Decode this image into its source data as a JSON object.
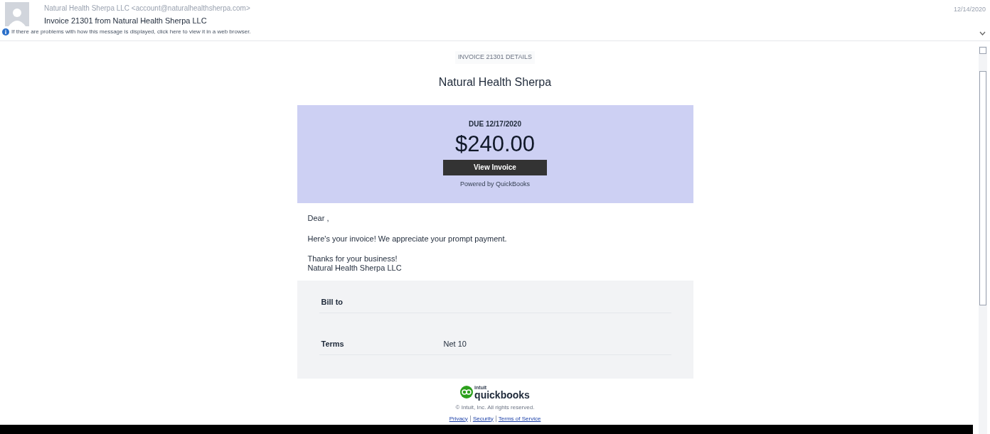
{
  "header": {
    "sender": "Natural Health Sherpa LLC <account@naturalhealthsherpa.com>",
    "subject": "Invoice 21301 from Natural Health Sherpa LLC",
    "info": "If there are problems with how this message is displayed, click here to view it in a web browser.",
    "date": "12/14/2020"
  },
  "email": {
    "heading": "INVOICE 21301 DETAILS",
    "company": "Natural Health Sherpa",
    "due": "DUE 12/17/2020",
    "amount": "$240.00",
    "button": "View Invoice",
    "powered": "Powered by QuickBooks",
    "greeting": "Dear ,",
    "message": "Here's your invoice! We appreciate your prompt payment.",
    "closing": [
      "Thanks for your business!",
      "Natural Health Sherpa LLC"
    ],
    "details": [
      {
        "label": "Bill to"
      },
      {
        "label": "Terms",
        "value": "Net 10"
      }
    ],
    "logo": {
      "small": "intuit",
      "name": "quickbooks"
    },
    "copyright": "© Intuit, Inc. All rights reserved.",
    "links": [
      {
        "label": "Privacy"
      },
      {
        "label": "Security"
      },
      {
        "label": "Terms of Service"
      }
    ]
  }
}
